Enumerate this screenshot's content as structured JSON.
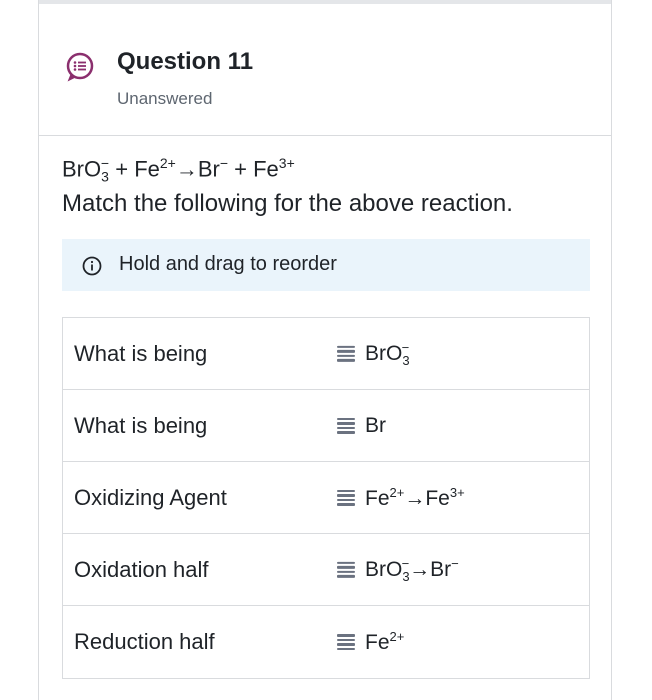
{
  "question": {
    "title": "Question 11",
    "status": "Unanswered",
    "equation": {
      "bro": "BrO",
      "bro_sub": "3",
      "bro_sup": "−",
      "plus1": " + ",
      "fe": "Fe",
      "fe_sup": "2+",
      "arrow": "→",
      "br": "Br",
      "br_sup": "−",
      "plus2": " + ",
      "fe2": "Fe",
      "fe2_sup": "3+"
    },
    "prompt": "Match the following for the above reaction."
  },
  "hint": {
    "icon": "info-icon",
    "text": "Hold and drag to reorder"
  },
  "match": {
    "rows": [
      {
        "left": "What is being",
        "right_main": "BrO",
        "right_sub": "3",
        "right_sup": "−",
        "right_tail": "",
        "right_tail_sup": ""
      },
      {
        "left": "What is being",
        "right_main": "Br",
        "right_sub": "",
        "right_sup": "",
        "right_tail": "",
        "right_tail_sup": ""
      },
      {
        "left": "Oxidizing Agent",
        "right_main": "Fe",
        "right_sub": "",
        "right_sup": "2+",
        "right_tail": "→Fe",
        "right_tail_sup": "3+"
      },
      {
        "left": "Oxidation half",
        "right_main": "BrO",
        "right_sub": "3",
        "right_sup": "−",
        "right_tail": "→Br",
        "right_tail_sup": "−"
      },
      {
        "left": "Reduction half",
        "right_main": "Fe",
        "right_sub": "",
        "right_sup": "2+",
        "right_tail": "",
        "right_tail_sup": ""
      }
    ]
  },
  "colors": {
    "accent": "#8b2f6e",
    "hint_bg": "#eaf4fb",
    "border": "#d9dbde"
  }
}
